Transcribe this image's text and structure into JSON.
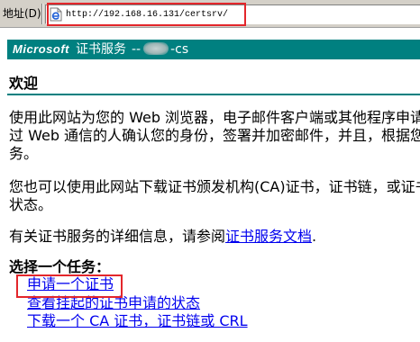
{
  "address_bar": {
    "label": "地址(D)",
    "url": "http://192.168.16.131/certsrv/"
  },
  "header": {
    "brand": "Microsoft",
    "service": "证书服务",
    "separator": "--",
    "server_suffix": "-cs"
  },
  "welcome": {
    "title": "欢迎"
  },
  "intro": {
    "paragraph1": [
      "使用此网站为您的 Web 浏览器，电子邮件客户端或其他程序申请",
      "过 Web 通信的人确认您的身份，签署并加密邮件，并且，根据您",
      "务。"
    ],
    "paragraph2": [
      "您也可以使用此网站下载证书颁发机构(CA)证书，证书链，或证书",
      "状态。"
    ],
    "paragraph3": {
      "prefix": "有关证书服务的详细信息，请参阅",
      "link": "证书服务文档",
      "suffix": "."
    }
  },
  "tasks": {
    "heading": "选择一个任务：",
    "items": [
      {
        "label": "申请一个证书"
      },
      {
        "label": "查看挂起的证书申请的状态"
      },
      {
        "label": "下载一个 CA 证书，证书链或 CRL"
      }
    ]
  },
  "colors": {
    "teal": "#008080",
    "link": "#0000ee",
    "highlight": "#e3262b",
    "chrome": "#d4d0c8"
  }
}
